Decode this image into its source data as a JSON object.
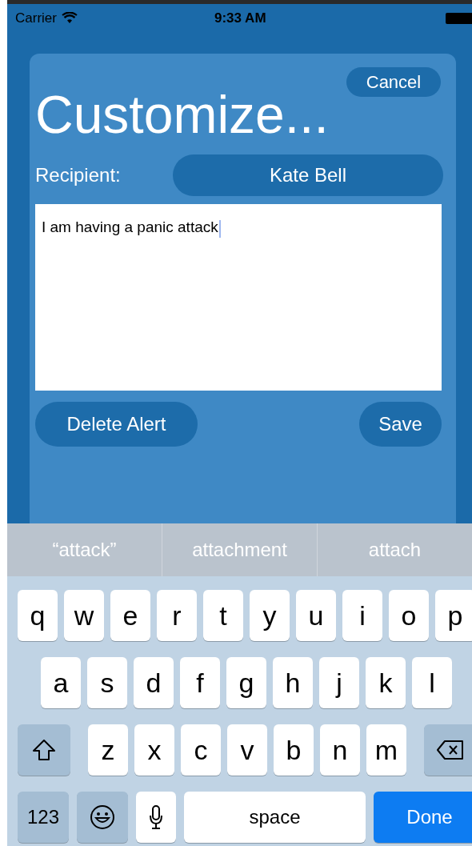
{
  "status_bar": {
    "carrier": "Carrier",
    "time": "9:33 AM"
  },
  "dialog": {
    "title": "Customize...",
    "cancel": "Cancel",
    "recipient_label": "Recipient:",
    "recipient": "Kate Bell",
    "message": {
      "value": "I am having a panic attack",
      "focused": true
    },
    "buttons": [
      {
        "label": "Delete Alert"
      },
      {
        "label": "Save"
      }
    ]
  },
  "suggestions": [
    "“attack”",
    "attachment",
    "attach"
  ],
  "keyboard": {
    "rows": [
      {
        "keys": [
          {
            "kind": "letter",
            "label": "q"
          },
          {
            "kind": "letter",
            "label": "w"
          },
          {
            "kind": "letter",
            "label": "e"
          },
          {
            "kind": "letter",
            "label": "r"
          },
          {
            "kind": "letter",
            "label": "t"
          },
          {
            "kind": "letter",
            "label": "y"
          },
          {
            "kind": "letter",
            "label": "u"
          },
          {
            "kind": "letter",
            "label": "i"
          },
          {
            "kind": "letter",
            "label": "o"
          },
          {
            "kind": "letter",
            "label": "p"
          }
        ]
      },
      {
        "keys": [
          {
            "kind": "letter",
            "label": "a"
          },
          {
            "kind": "letter",
            "label": "s"
          },
          {
            "kind": "letter",
            "label": "d"
          },
          {
            "kind": "letter",
            "label": "f"
          },
          {
            "kind": "letter",
            "label": "g"
          },
          {
            "kind": "letter",
            "label": "h"
          },
          {
            "kind": "letter",
            "label": "j"
          },
          {
            "kind": "letter",
            "label": "k"
          },
          {
            "kind": "letter",
            "label": "l"
          }
        ]
      },
      {
        "keys": [
          {
            "kind": "shift"
          },
          {
            "kind": "letter",
            "label": "z"
          },
          {
            "kind": "letter",
            "label": "x"
          },
          {
            "kind": "letter",
            "label": "c"
          },
          {
            "kind": "letter",
            "label": "v"
          },
          {
            "kind": "letter",
            "label": "b"
          },
          {
            "kind": "letter",
            "label": "n"
          },
          {
            "kind": "letter",
            "label": "m"
          },
          {
            "kind": "backspace"
          }
        ]
      },
      {
        "keys": [
          {
            "kind": "numbers",
            "label": "123"
          },
          {
            "kind": "emoji"
          },
          {
            "kind": "mic"
          },
          {
            "kind": "space",
            "label": "space"
          },
          {
            "kind": "done",
            "label": "Done"
          }
        ]
      }
    ]
  }
}
